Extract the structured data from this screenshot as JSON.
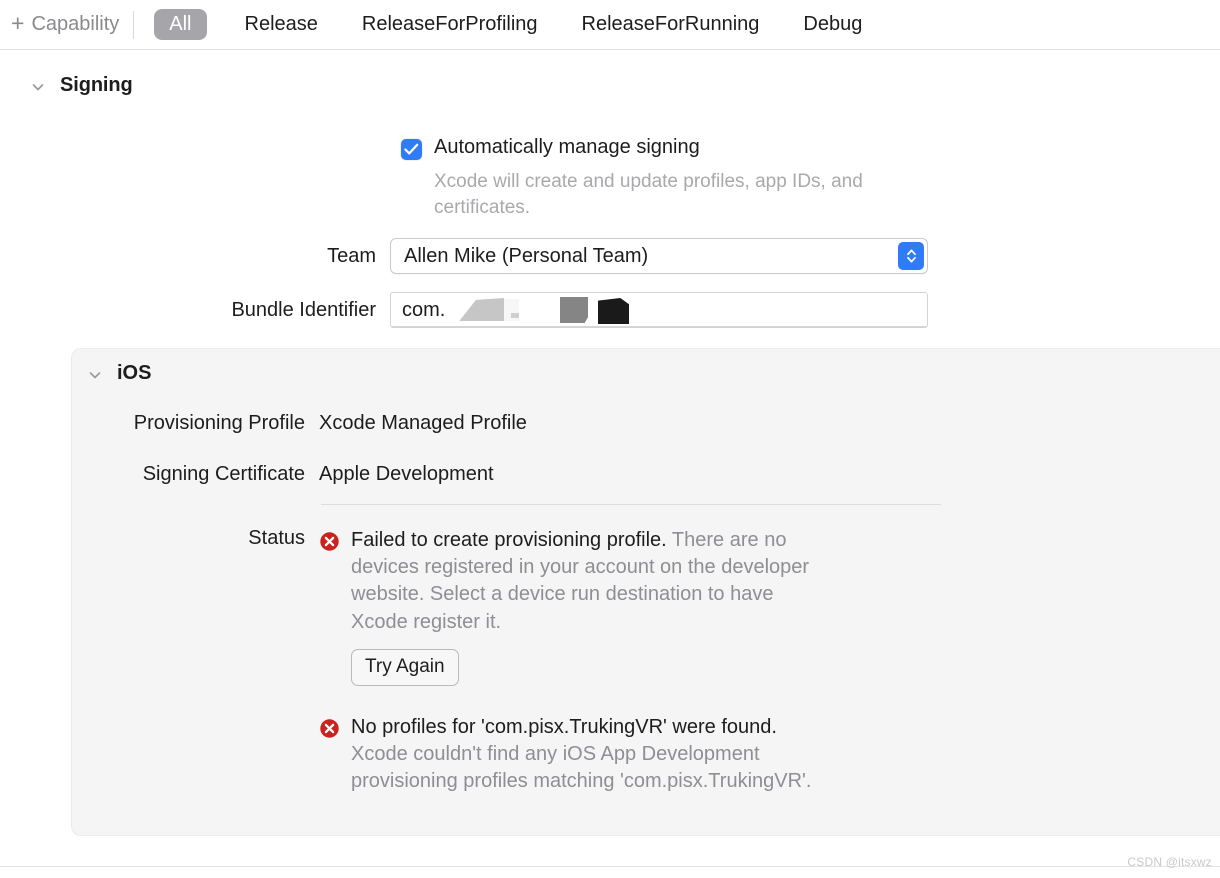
{
  "toolbar": {
    "capability_button": "Capability",
    "capability_icon": "plus-icon",
    "tabs": [
      {
        "label": "All",
        "selected": true
      },
      {
        "label": "Release",
        "selected": false
      },
      {
        "label": "ReleaseForProfiling",
        "selected": false
      },
      {
        "label": "ReleaseForRunning",
        "selected": false
      },
      {
        "label": "Debug",
        "selected": false
      }
    ]
  },
  "signing": {
    "title": "Signing",
    "disclosure_icon": "chevron-down-icon",
    "auto_manage": {
      "label": "Automatically manage signing",
      "checked": true,
      "description": "Xcode will create and update profiles, app IDs, and certificates."
    },
    "team": {
      "label": "Team",
      "value": "Allen Mike (Personal Team)",
      "stepper_icon": "chevron-up-down-icon"
    },
    "bundle_identifier": {
      "label": "Bundle Identifier",
      "value": "com.",
      "redacted": true
    }
  },
  "ios_group": {
    "title": "iOS",
    "disclosure_icon": "chevron-down-icon",
    "rows": [
      {
        "label": "Provisioning Profile",
        "value": "Xcode Managed Profile"
      },
      {
        "label": "Signing Certificate",
        "value": "Apple Development"
      }
    ],
    "status": {
      "label": "Status",
      "messages": [
        {
          "icon": "error-icon",
          "headline": "Failed to create provisioning profile.",
          "detail": " There are no devices registered in your account on the developer website. Select a device run destination to have Xcode register it.",
          "action_label": "Try Again"
        },
        {
          "icon": "error-icon",
          "headline": "No profiles for 'com.pisx.TrukingVR' were found.",
          "detail": " Xcode couldn't find any iOS App Development provisioning profiles matching 'com.pisx.TrukingVR'.",
          "action_label": null
        }
      ]
    }
  },
  "watermark": "CSDN @itsxwz",
  "colors": {
    "accent_blue": "#2f7cf6",
    "error_red": "#c9221f",
    "pill_gray": "#a6a6aa",
    "panel_bg": "#f5f5f5",
    "muted_text": "#8e8e93",
    "placeholder_text": "#a9a9ad"
  }
}
